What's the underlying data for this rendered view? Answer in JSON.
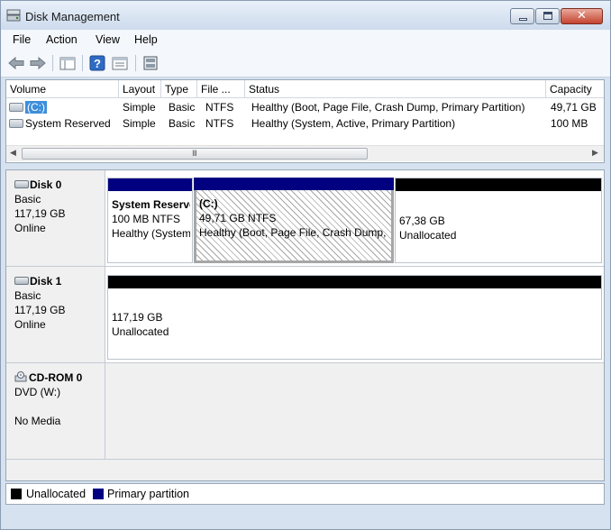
{
  "window": {
    "title": "Disk Management"
  },
  "menu": [
    "File",
    "Action",
    "View",
    "Help"
  ],
  "toolbar": {
    "buttons": [
      "back-arrow-icon",
      "forward-arrow-icon",
      "console-tree-icon",
      "help-icon",
      "properties-icon",
      "rescan-disks-icon"
    ]
  },
  "volume_list": {
    "columns": [
      "Volume",
      "Layout",
      "Type",
      "File ...",
      "Status",
      "Capacity"
    ],
    "rows": [
      {
        "volume": "(C:)",
        "layout": "Simple",
        "type": "Basic",
        "fs": "NTFS",
        "status": "Healthy (Boot, Page File, Crash Dump, Primary Partition)",
        "capacity": "49,71 GB"
      },
      {
        "volume": "System Reserved",
        "layout": "Simple",
        "type": "Basic",
        "fs": "NTFS",
        "status": "Healthy (System, Active, Primary Partition)",
        "capacity": "100 MB"
      }
    ],
    "scroll_grip": "III"
  },
  "disks": [
    {
      "name": "Disk 0",
      "kind": "Basic",
      "size": "117,19 GB",
      "state": "Online",
      "partitions": [
        {
          "title": "System Reserved",
          "line1": "100 MB NTFS",
          "line2": "Healthy (System, Active, Primary Partition)",
          "bar": "primary"
        },
        {
          "title": "(C:)",
          "line1": "49,71 GB NTFS",
          "line2": "Healthy (Boot, Page File, Crash Dump, Primary Partition)",
          "bar": "primary"
        },
        {
          "title": "",
          "line1": "67,38 GB",
          "line2": "Unallocated",
          "bar": "unallocated"
        }
      ]
    },
    {
      "name": "Disk 1",
      "kind": "Basic",
      "size": "117,19 GB",
      "state": "Online",
      "partitions": [
        {
          "title": "",
          "line1": "117,19 GB",
          "line2": "Unallocated",
          "bar": "unallocated"
        }
      ]
    },
    {
      "name": "CD-ROM 0",
      "kind": "DVD (W:)",
      "size": "",
      "state": "No Media",
      "partitions": []
    }
  ],
  "legend": [
    {
      "label": "Unallocated",
      "color": "#000000"
    },
    {
      "label": "Primary partition",
      "color": "#000080"
    }
  ]
}
